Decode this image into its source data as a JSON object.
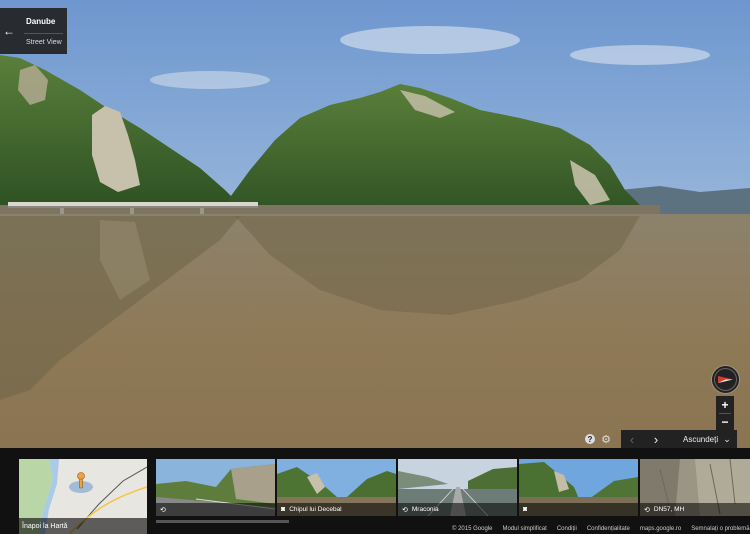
{
  "location_card": {
    "title": "Danube",
    "subtitle": "Street View",
    "back_icon": "arrow-left-icon"
  },
  "controls": {
    "compass_icon": "compass-icon",
    "zoom_in": "+",
    "zoom_out": "−",
    "help_icon": "?",
    "settings_icon": "⚙"
  },
  "filmstrip_nav": {
    "prev_label": "‹",
    "next_label": "›",
    "hide_label": "Ascundeți",
    "hide_chevron": "⌄"
  },
  "map_thumb": {
    "label": "Înapoi la Hartă"
  },
  "thumbnails": [
    {
      "label": "",
      "icon": "360-icon"
    },
    {
      "label": "Chipul lui Decebal",
      "icon": "camera-icon"
    },
    {
      "label": "Mraconia",
      "icon": "360-icon"
    },
    {
      "label": "",
      "icon": "camera-icon"
    },
    {
      "label": "DN57, MH",
      "icon": "360-icon"
    }
  ],
  "footer": {
    "copyright": "© 2015 Google",
    "links": [
      "Modul simplificat",
      "Condiții",
      "Confidențialitate",
      "maps.google.ro",
      "Semnalați o problemă"
    ]
  },
  "colors": {
    "sky": "#8fb3dd",
    "water": "#8d7c5e",
    "forest": "#3f6a2a",
    "panel": "#222222"
  }
}
